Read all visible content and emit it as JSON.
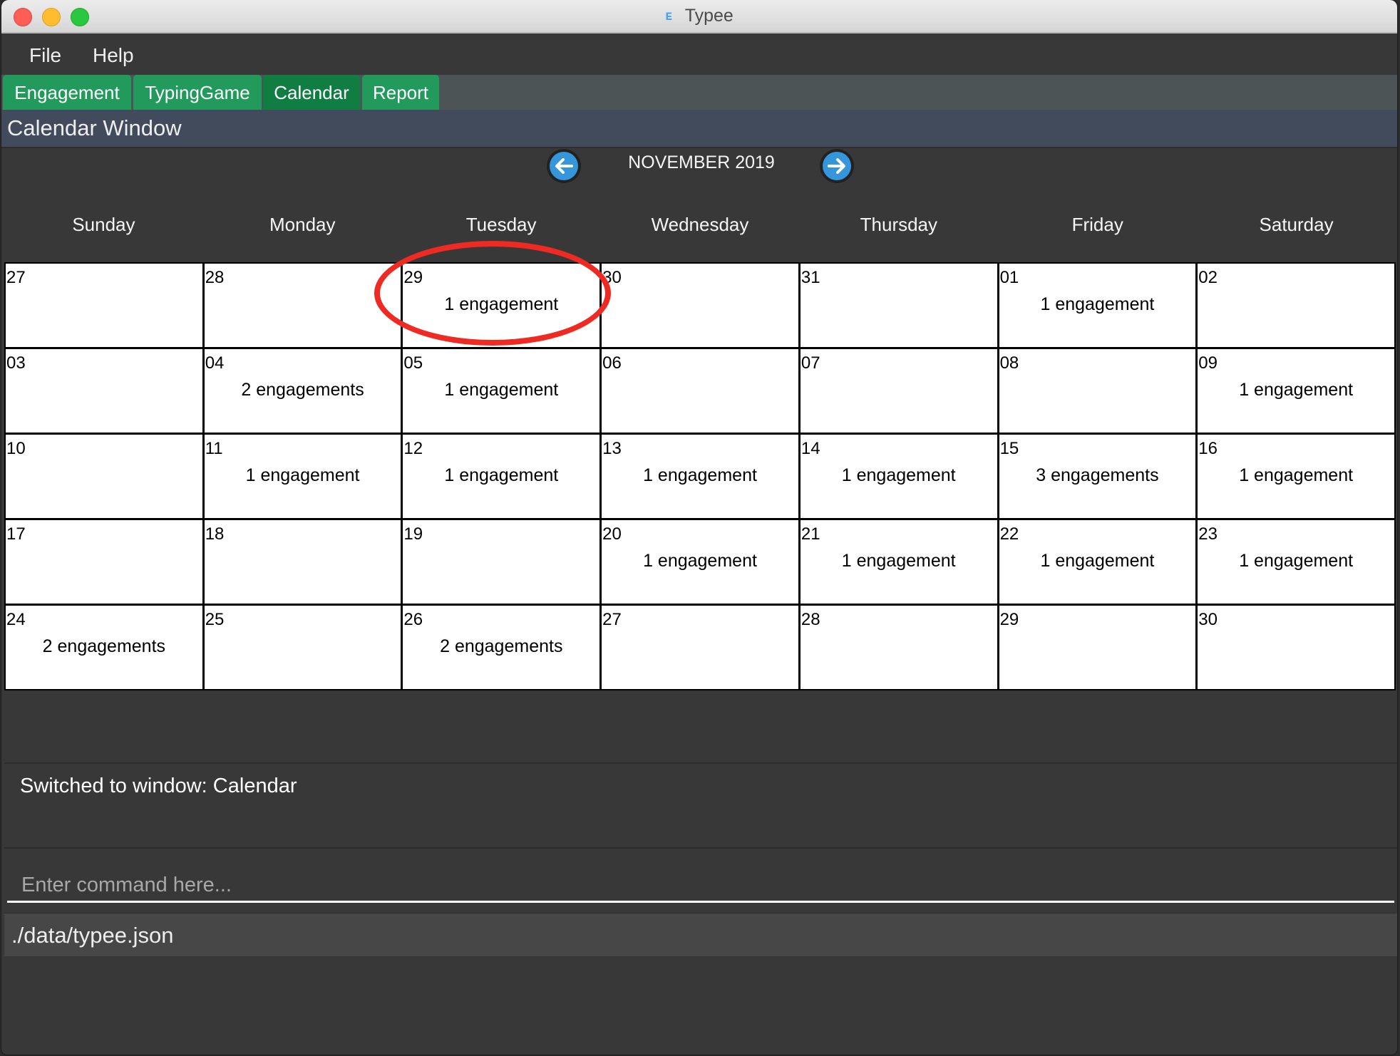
{
  "window": {
    "title": "Typee",
    "app_icon": "typee-logo-icon",
    "traffic_lights": [
      "close",
      "minimize",
      "zoom"
    ]
  },
  "menu": {
    "items": [
      {
        "label": "File"
      },
      {
        "label": "Help"
      }
    ]
  },
  "tabs": [
    {
      "label": "Engagement",
      "active": false
    },
    {
      "label": "TypingGame",
      "active": false
    },
    {
      "label": "Calendar",
      "active": true
    },
    {
      "label": "Report",
      "active": false
    }
  ],
  "header": {
    "title": "Calendar Window"
  },
  "calendar": {
    "month_label": "NOVEMBER 2019",
    "prev_icon": "arrow-left-icon",
    "next_icon": "arrow-right-icon",
    "weekdays": [
      "Sunday",
      "Monday",
      "Tuesday",
      "Wednesday",
      "Thursday",
      "Friday",
      "Saturday"
    ],
    "highlighted_cell": "29",
    "cells": [
      {
        "day": "27",
        "count": ""
      },
      {
        "day": "28",
        "count": ""
      },
      {
        "day": "29",
        "count": "1 engagement"
      },
      {
        "day": "30",
        "count": ""
      },
      {
        "day": "31",
        "count": ""
      },
      {
        "day": "01",
        "count": "1 engagement"
      },
      {
        "day": "02",
        "count": ""
      },
      {
        "day": "03",
        "count": ""
      },
      {
        "day": "04",
        "count": "2 engagements"
      },
      {
        "day": "05",
        "count": "1 engagement"
      },
      {
        "day": "06",
        "count": ""
      },
      {
        "day": "07",
        "count": ""
      },
      {
        "day": "08",
        "count": ""
      },
      {
        "day": "09",
        "count": "1 engagement"
      },
      {
        "day": "10",
        "count": ""
      },
      {
        "day": "11",
        "count": "1 engagement"
      },
      {
        "day": "12",
        "count": "1 engagement"
      },
      {
        "day": "13",
        "count": "1 engagement"
      },
      {
        "day": "14",
        "count": "1 engagement"
      },
      {
        "day": "15",
        "count": "3 engagements"
      },
      {
        "day": "16",
        "count": "1 engagement"
      },
      {
        "day": "17",
        "count": ""
      },
      {
        "day": "18",
        "count": ""
      },
      {
        "day": "19",
        "count": ""
      },
      {
        "day": "20",
        "count": "1 engagement"
      },
      {
        "day": "21",
        "count": "1 engagement"
      },
      {
        "day": "22",
        "count": "1 engagement"
      },
      {
        "day": "23",
        "count": "1 engagement"
      },
      {
        "day": "24",
        "count": "2 engagements"
      },
      {
        "day": "25",
        "count": ""
      },
      {
        "day": "26",
        "count": "2 engagements"
      },
      {
        "day": "27",
        "count": ""
      },
      {
        "day": "28",
        "count": ""
      },
      {
        "day": "29",
        "count": ""
      },
      {
        "day": "30",
        "count": ""
      }
    ]
  },
  "result": {
    "text": "Switched to window: Calendar"
  },
  "command": {
    "value": "",
    "placeholder": "Enter command here..."
  },
  "status": {
    "path": "./data/typee.json"
  },
  "colors": {
    "tab": "#229a5c",
    "tab_active": "#107e42",
    "header": "#424b5c",
    "nav_button": "#3596dc",
    "highlight": "#ef2a22",
    "background": "#383838"
  }
}
